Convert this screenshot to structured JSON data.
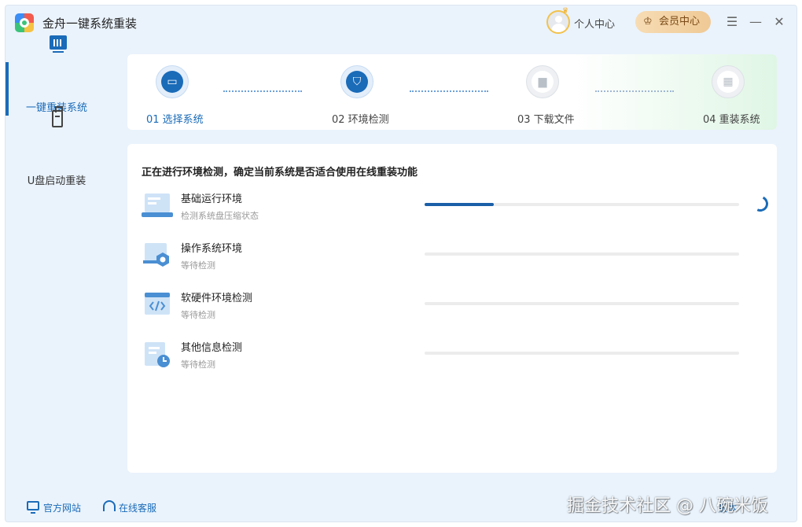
{
  "app": {
    "title": "金舟一键系统重装",
    "personal_center": "个人中心",
    "vip_center": "会员中心"
  },
  "sidebar": {
    "items": [
      {
        "label": "一键重装系统",
        "active": true
      },
      {
        "label": "U盘启动重装",
        "active": false
      }
    ]
  },
  "steps": [
    {
      "label": "01 选择系统",
      "state": "active",
      "icon": "monitor-icon"
    },
    {
      "label": "02 环境检测",
      "state": "active",
      "icon": "shield-icon"
    },
    {
      "label": "03 下载文件",
      "state": "pending",
      "icon": "folder-icon"
    },
    {
      "label": "04 重装系统",
      "state": "pending",
      "icon": "grid-icon"
    }
  ],
  "main": {
    "heading": "正在进行环境检测，确定当前系统是否适合使用在线重装功能",
    "checks": [
      {
        "title": "基础运行环境",
        "status": "检测系统盘压缩状态",
        "progress": 0.22,
        "icon": "laptop-icon",
        "running": true
      },
      {
        "title": "操作系统环境",
        "status": "等待检测",
        "progress": 0,
        "icon": "os-settings-icon",
        "running": false
      },
      {
        "title": "软硬件环境检测",
        "status": "等待检测",
        "progress": 0,
        "icon": "code-window-icon",
        "running": false
      },
      {
        "title": "其他信息检测",
        "status": "等待检测",
        "progress": 0,
        "icon": "document-clock-icon",
        "running": false
      }
    ]
  },
  "footer": {
    "website": "官方网站",
    "support": "在线客服",
    "version": "版本"
  },
  "watermark": "掘金技术社区 @ 八碗米饭",
  "colors": {
    "accent": "#1a6bb8",
    "progress": "#1a5fa8",
    "background": "#eaf3fc",
    "vip_gold": "#efc995"
  }
}
